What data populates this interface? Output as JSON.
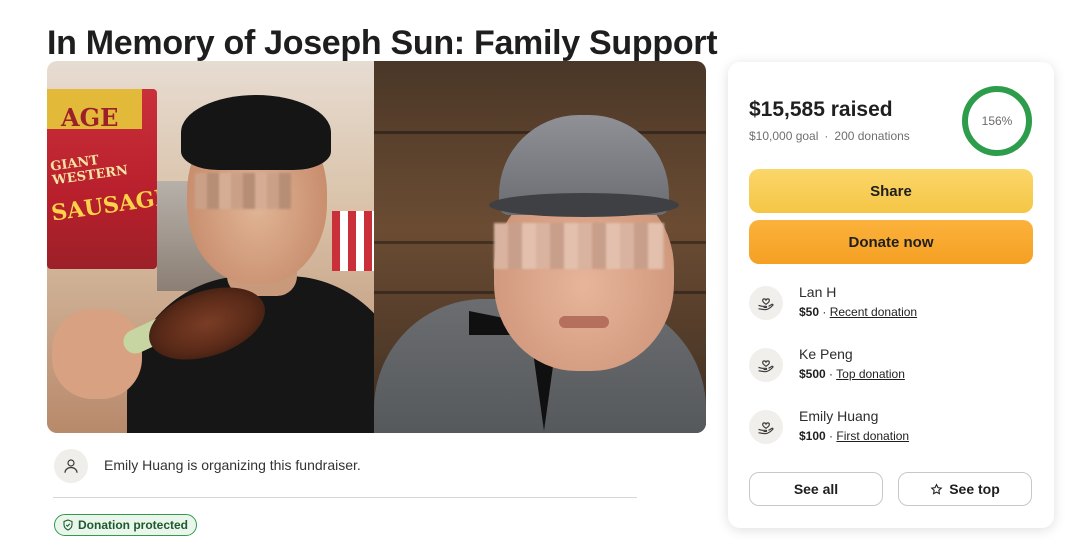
{
  "page": {
    "title": "In Memory of Joseph Sun: Family Support"
  },
  "photo": {
    "sign_line1": "AGE",
    "sign_line2": "GIANT WESTERN",
    "sign_line3": "SAUSAGE"
  },
  "organizer": {
    "text": "Emily Huang is organizing this fundraiser."
  },
  "badge": {
    "label": "Donation protected"
  },
  "card": {
    "raised": "$15,585 raised",
    "goal": "$10,000 goal",
    "donations": "200 donations",
    "progress_label": "156%",
    "progress_fraction": 1.0,
    "share_label": "Share",
    "donate_label": "Donate now",
    "donors": [
      {
        "name": "Lan H",
        "amount": "$50",
        "tag": "Recent donation"
      },
      {
        "name": "Ke Peng",
        "amount": "$500",
        "tag": "Top donation"
      },
      {
        "name": "Emily Huang",
        "amount": "$100",
        "tag": "First donation"
      }
    ],
    "see_all_label": "See all",
    "see_top_label": "See top"
  },
  "colors": {
    "accent_green": "#2e9d4b",
    "share_yellow": "#f5c645",
    "donate_orange": "#f5a023"
  },
  "icons": {
    "organizer": "user-icon",
    "donor": "heart-hand-icon",
    "badge": "shield-check-icon",
    "see_top": "star-icon"
  }
}
